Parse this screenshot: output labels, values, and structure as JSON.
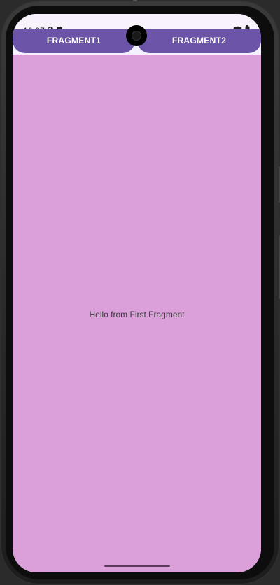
{
  "status_bar": {
    "time": "10:37",
    "left_icons": [
      "data-saver-icon",
      "sim-icon"
    ],
    "right_icons": [
      "wifi-icon",
      "battery-icon"
    ]
  },
  "tabs": [
    {
      "label": "FRAGMENT1"
    },
    {
      "label": "FRAGMENT2"
    }
  ],
  "content": {
    "message": "Hello from First Fragment"
  },
  "colors": {
    "tab_background": "#6c54a8",
    "content_background": "#dba0da",
    "status_bar_background": "#f7f2fb"
  }
}
